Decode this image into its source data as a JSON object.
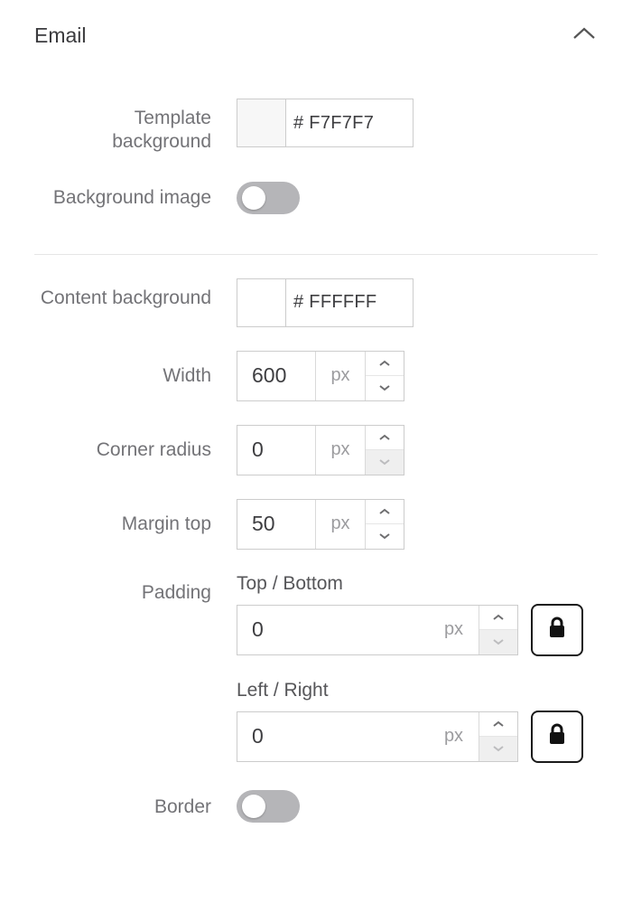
{
  "panel": {
    "title": "Email"
  },
  "template_bg": {
    "label": "Template background",
    "hex": "F7F7F7",
    "prefix": "#",
    "swatch": "#F7F7F7"
  },
  "bg_image": {
    "label": "Background image",
    "on": false
  },
  "content_bg": {
    "label": "Content background",
    "hex": "FFFFFF",
    "prefix": "#",
    "swatch": "#FFFFFF"
  },
  "width": {
    "label": "Width",
    "value": "600",
    "unit": "px"
  },
  "corner_radius": {
    "label": "Corner radius",
    "value": "0",
    "unit": "px"
  },
  "margin_top": {
    "label": "Margin top",
    "value": "50",
    "unit": "px"
  },
  "padding": {
    "label": "Padding",
    "tb_label": "Top / Bottom",
    "tb_value": "0",
    "tb_unit": "px",
    "lr_label": "Left / Right",
    "lr_value": "0",
    "lr_unit": "px"
  },
  "border": {
    "label": "Border",
    "on": false
  }
}
